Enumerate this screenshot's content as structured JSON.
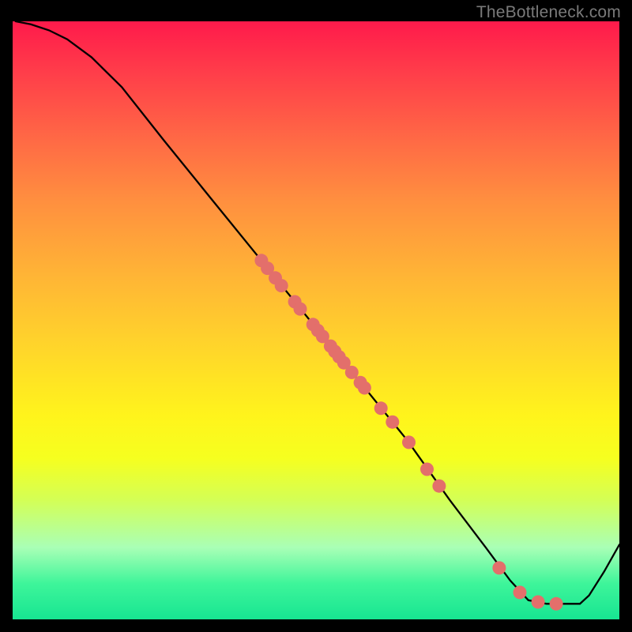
{
  "watermark": "TheBottleneck.com",
  "chart_data": {
    "type": "line",
    "title": "",
    "xlabel": "",
    "ylabel": "",
    "xlim": [
      0,
      100
    ],
    "ylim": [
      0,
      100
    ],
    "curve": [
      {
        "x": 0.5,
        "y": 100
      },
      {
        "x": 3,
        "y": 99.5
      },
      {
        "x": 6,
        "y": 98.5
      },
      {
        "x": 9,
        "y": 97
      },
      {
        "x": 13,
        "y": 94
      },
      {
        "x": 18,
        "y": 89
      },
      {
        "x": 25,
        "y": 80
      },
      {
        "x": 33,
        "y": 70
      },
      {
        "x": 41,
        "y": 60
      },
      {
        "x": 49,
        "y": 50
      },
      {
        "x": 57,
        "y": 40
      },
      {
        "x": 65,
        "y": 30
      },
      {
        "x": 72,
        "y": 20
      },
      {
        "x": 78,
        "y": 12
      },
      {
        "x": 82,
        "y": 6.5
      },
      {
        "x": 85,
        "y": 3.2
      },
      {
        "x": 88,
        "y": 2.6
      },
      {
        "x": 91,
        "y": 2.6
      },
      {
        "x": 93.5,
        "y": 2.6
      },
      {
        "x": 95,
        "y": 4
      },
      {
        "x": 97.5,
        "y": 8
      },
      {
        "x": 100,
        "y": 12.5
      }
    ],
    "markers": [
      {
        "x": 41,
        "y": 60
      },
      {
        "x": 42,
        "y": 58.7
      },
      {
        "x": 43.3,
        "y": 57.1
      },
      {
        "x": 44.3,
        "y": 55.8
      },
      {
        "x": 46.5,
        "y": 53.1
      },
      {
        "x": 47.4,
        "y": 51.9
      },
      {
        "x": 49.5,
        "y": 49.3
      },
      {
        "x": 50.3,
        "y": 48.3
      },
      {
        "x": 51.1,
        "y": 47.3
      },
      {
        "x": 52.4,
        "y": 45.7
      },
      {
        "x": 53.1,
        "y": 44.8
      },
      {
        "x": 53.8,
        "y": 43.9
      },
      {
        "x": 54.6,
        "y": 42.9
      },
      {
        "x": 55.9,
        "y": 41.3
      },
      {
        "x": 57.3,
        "y": 39.6
      },
      {
        "x": 58,
        "y": 38.7
      },
      {
        "x": 60.7,
        "y": 35.3
      },
      {
        "x": 62.6,
        "y": 33
      },
      {
        "x": 65.3,
        "y": 29.6
      },
      {
        "x": 68.3,
        "y": 25.1
      },
      {
        "x": 70.3,
        "y": 22.3
      },
      {
        "x": 80.2,
        "y": 8.6
      },
      {
        "x": 83.6,
        "y": 4.5
      },
      {
        "x": 86.6,
        "y": 2.9
      },
      {
        "x": 89.6,
        "y": 2.6
      }
    ],
    "marker_color": "#e36f6b",
    "line_color": "#000000"
  }
}
